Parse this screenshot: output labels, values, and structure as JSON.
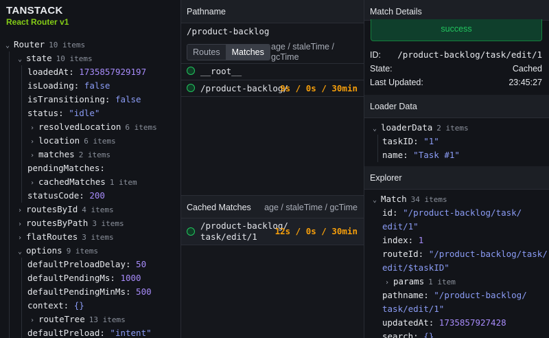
{
  "brand": {
    "title": "TANSTACK",
    "subtitle": "React Router v1"
  },
  "state_tree": {
    "router_key": "Router",
    "router_count": "10 items",
    "state_key": "state",
    "state_count": "10 items",
    "loadedAt_key": "loadedAt:",
    "loadedAt_val": "1735857929197",
    "isLoading_key": "isLoading:",
    "isLoading_val": "false",
    "isTransitioning_key": "isTransitioning:",
    "isTransitioning_val": "false",
    "status_key": "status:",
    "status_val": "\"idle\"",
    "resolvedLocation_key": "resolvedLocation",
    "resolvedLocation_count": "6 items",
    "location_key": "location",
    "location_count": "6 items",
    "matches_key": "matches",
    "matches_count": "2 items",
    "pendingMatches_key": "pendingMatches:",
    "cachedMatches_key": "cachedMatches",
    "cachedMatches_count": "1 item",
    "statusCode_key": "statusCode:",
    "statusCode_val": "200",
    "routesById_key": "routesById",
    "routesById_count": "4 items",
    "routesByPath_key": "routesByPath",
    "routesByPath_count": "3 items",
    "flatRoutes_key": "flatRoutes",
    "flatRoutes_count": "3 items",
    "options_key": "options",
    "options_count": "9 items",
    "defaultPreloadDelay_key": "defaultPreloadDelay:",
    "defaultPreloadDelay_val": "50",
    "defaultPendingMs_key": "defaultPendingMs:",
    "defaultPendingMs_val": "1000",
    "defaultPendingMinMs_key": "defaultPendingMinMs:",
    "defaultPendingMinMs_val": "500",
    "context_key": "context:",
    "context_val": "{}",
    "routeTree_key": "routeTree",
    "routeTree_count": "13 items",
    "defaultPreload_key": "defaultPreload:",
    "defaultPreload_val": "\"intent\""
  },
  "middle": {
    "pathname_header": "Pathname",
    "pathname_value": "/product-backlog",
    "toggle_routes": "Routes",
    "toggle_matches": "Matches",
    "col_hint_line1": "age / staleTime /",
    "col_hint_line2": "gcTime",
    "matches": [
      {
        "path": "__root__",
        "timing": ""
      },
      {
        "path": "/product-backlog/",
        "timing": "9s / 0s / 30min"
      }
    ],
    "cached_header": "Cached Matches",
    "cached_col_hint": "age / staleTime / gcTime",
    "cached": [
      {
        "path_line1": "/product-backlog/",
        "path_line2": "task/edit/1",
        "timing": "12s / 0s / 30min"
      }
    ]
  },
  "right": {
    "match_details_header": "Match Details",
    "status_badge": "success",
    "id_label": "ID:",
    "id_value": "/product-backlog/task/edit/1",
    "state_label": "State:",
    "state_value": "Cached",
    "updated_label": "Last Updated:",
    "updated_value": "23:45:27",
    "loader_header": "Loader Data",
    "loaderData_key": "loaderData",
    "loaderData_count": "2 items",
    "taskID_key": "taskID:",
    "taskID_val": "\"1\"",
    "name_key": "name:",
    "name_val": "\"Task #1\"",
    "explorer_header": "Explorer",
    "match_key": "Match",
    "match_count": "34 items",
    "id_key": "id:",
    "id_val_l1": "\"/product-backlog/task/",
    "id_val_l2": "edit/1\"",
    "index_key": "index:",
    "index_val": "1",
    "routeId_key": "routeId:",
    "routeId_val_l1": "\"/product-backlog/task/",
    "routeId_val_l2": "edit/$taskID\"",
    "params_key": "params",
    "params_count": "1 item",
    "pathname_key": "pathname:",
    "pathname_val_l1": "\"/product-backlog/",
    "pathname_val_l2": "task/edit/1\"",
    "updatedAt_key": "updatedAt:",
    "updatedAt_val": "1735857927428",
    "search_key": "search:",
    "search_val": "{}"
  }
}
